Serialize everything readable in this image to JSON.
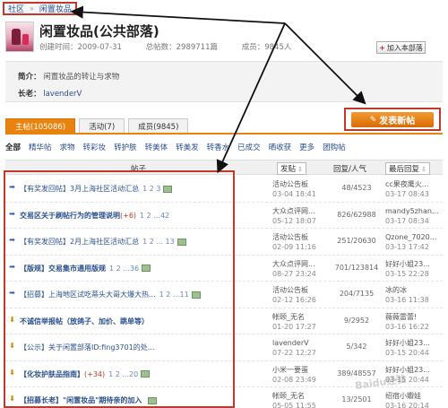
{
  "breadcrumb": [
    "社区",
    "闲置妆品"
  ],
  "group": {
    "title": "闲置妆品(公共部落)",
    "created_label": "创建时间：",
    "created": "2009-07-31",
    "total_posts_label": "总帖数：",
    "total_posts": "2989711篇",
    "members_label": "成员：",
    "members": "9845人",
    "join_button": "加入本部落"
  },
  "intro": {
    "label": "简介：",
    "text": "闲置妆品的转让与求物",
    "owner_label": "长老：",
    "owner": "lavenderV"
  },
  "post_button": "发表新帖",
  "tabs": [
    {
      "label": "主帖(105086)",
      "active": true
    },
    {
      "label": "活动(7)",
      "active": false
    },
    {
      "label": "成员(9845)",
      "active": false
    }
  ],
  "filters": [
    "全部",
    "精华帖",
    "求物",
    "转彩妆",
    "转护肤",
    "转美体",
    "转美发",
    "转香水",
    "已成交",
    "晒收获",
    "更多",
    "团购帖"
  ],
  "table_header": {
    "subject": "帖子",
    "author": "发贴",
    "reply_view": "回复/人气",
    "last": "最后回复"
  },
  "rows": [
    {
      "icon": "pin",
      "tag": "【有奖发回帖】",
      "title": "3月上海社区活动汇总",
      "bold": false,
      "title_red": false,
      "extra": "",
      "pages": "1 2 3",
      "pic": true,
      "author": "活动公告板",
      "date": "03-04 18:41",
      "rv": "48/4523",
      "last_user": "cc果夜鹰火...",
      "last_date": "03-17 08:43"
    },
    {
      "icon": "pin",
      "tag": "",
      "title": "交易区关于刷帖行为的管理说明",
      "bold": true,
      "title_red": false,
      "extra": "(+6)",
      "pages": "1 2 ...42",
      "pic": false,
      "author": "大众点评网...",
      "date": "05-12 18:07",
      "rv": "826/62988",
      "last_user": "mandy5zhan...",
      "last_date": "03-17 08:34"
    },
    {
      "icon": "pin",
      "tag": "【有奖发回帖】",
      "title": "2月上海社区活动汇总",
      "bold": false,
      "title_red": false,
      "extra": "",
      "pages": "1 2 ... 13",
      "pic": true,
      "author": "活动公告板",
      "date": "02-09 11:16",
      "rv": "251/20630",
      "last_user": "Qzone_7020...",
      "last_date": "03-13 17:42"
    },
    {
      "icon": "pin",
      "tag": "【版规】",
      "title": "交易集市通用版规",
      "bold": true,
      "title_red": false,
      "extra": "",
      "pages": "1 2 ...36",
      "pic": true,
      "author": "大众点评网...",
      "date": "08-27 23:24",
      "rv": "701/123814",
      "last_user": "好好小姐23...",
      "last_date": "03-15 22:28"
    },
    {
      "icon": "pin",
      "tag": "【招募】",
      "title": "上海地区试吃蒂头大哥大爆大热...",
      "bold": false,
      "title_red": false,
      "extra": "",
      "pages": "1 2 ...11",
      "pic": true,
      "author": "活动公告板",
      "date": "02-12 16:26",
      "rv": "204/7135",
      "last_user": "冰的冰",
      "last_date": "03-16 11:38"
    },
    {
      "icon": "gold",
      "tag": "",
      "title": "不诚信举报帖（放鸽子、加价、跳单等）",
      "bold": true,
      "title_red": false,
      "extra": "",
      "pages": "",
      "pic": false,
      "author": "帐颐_无名",
      "date": "01-20 17:27",
      "rv": "9/2952",
      "last_user": "薇薇雷蕾!",
      "last_date": "03-16 16:22"
    },
    {
      "icon": "gold",
      "tag": "【公示】",
      "title": "关于闲置部落ID:fing3701的处...",
      "bold": false,
      "title_red": false,
      "extra": "",
      "pages": "",
      "pic": false,
      "author": "lavenderV",
      "date": "07-22 12:27",
      "rv": "5/342",
      "last_user": "好好小姐23...",
      "last_date": "03-15 20:44"
    },
    {
      "icon": "gold",
      "tag": "【化妆护肤品指南】",
      "title": "",
      "bold": true,
      "title_red": false,
      "extra": "(+34)",
      "pages": "1 2 ...20",
      "pic": true,
      "author": "小米一要蛋",
      "date": "02-08 23:49",
      "rv": "389/48557",
      "last_user": "好好小姐23...",
      "last_date": "03-15 20:44"
    },
    {
      "icon": "gold",
      "tag": "【招募长老】",
      "title": "\"闲置妆品\"期待亲的加入",
      "bold": true,
      "title_red": false,
      "extra": "",
      "pages": "",
      "pic": true,
      "author": "帐颐_无名",
      "date": "05-05 11:55",
      "rv": "13/2501",
      "last_user": "绍宿小瓣娃",
      "last_date": "03-16 20:14"
    }
  ],
  "watermark": "Baidu经验"
}
